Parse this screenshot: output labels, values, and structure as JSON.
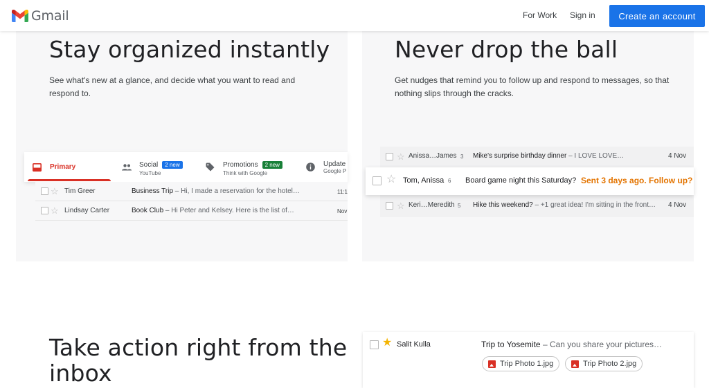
{
  "header": {
    "logo_text": "Gmail",
    "nav": {
      "for_work": "For Work",
      "sign_in": "Sign in"
    },
    "cta_label": "Create an account",
    "brand_colors": {
      "blue": "#1a73e8",
      "red": "#d93025",
      "green": "#188038",
      "yellow": "#f9ab00"
    }
  },
  "section_organized": {
    "title": "Stay organized instantly",
    "body": "See what's new at a glance, and decide what you want to read and respond to.",
    "tabs": [
      {
        "label": "Primary",
        "icon": "inbox-icon"
      },
      {
        "label": "Social",
        "sub": "YouTube",
        "badge": "2 new",
        "icon": "people-icon",
        "badge_color": "#1a73e8"
      },
      {
        "label": "Promotions",
        "sub": "Think with Google",
        "badge": "2 new",
        "icon": "tag-icon",
        "badge_color": "#188038"
      },
      {
        "label": "Update",
        "sub": "Google P",
        "icon": "info-icon"
      }
    ],
    "rows": [
      {
        "sender": "Tim Greer",
        "subject": "Business Trip",
        "snippet": " – Hi, I made a reservation for the hotel…",
        "date": "11:1"
      },
      {
        "sender": "Lindsay Carter",
        "subject": "Book Club",
        "snippet": " – Hi Peter and Kelsey. Here is the list of…",
        "date": "Nov"
      }
    ]
  },
  "section_nudges": {
    "title": "Never drop the ball",
    "body": "Get nudges that remind you to follow up and respond to messages, so that nothing slips through the cracks.",
    "rows": [
      {
        "sender": "Anissa…James",
        "count": "3",
        "subject": "Mike's surprise birthday dinner",
        "snippet": " – I LOVE LOVE…",
        "date": "4 Nov"
      },
      {
        "sender": "Tom, Anissa",
        "count": "6",
        "subject": "Board game night this Saturday?",
        "nudge": "Sent 3 days ago. Follow up?"
      },
      {
        "sender": "Keri…Meredith",
        "count": "5",
        "subject": "Hike this weekend?",
        "snippet": " – +1 great idea! I'm sitting in the front…",
        "date": "4 Nov"
      }
    ],
    "nudge_color": "#e37400"
  },
  "section_action": {
    "title_line1": "Take action right from the",
    "title_line2": "inbox",
    "row": {
      "sender": "Salit Kulla",
      "subject": "Trip to Yosemite",
      "snippet": " – Can you share your pictures…"
    },
    "attachments": [
      "Trip Photo 1.jpg",
      "Trip Photo 2.jpg"
    ]
  }
}
